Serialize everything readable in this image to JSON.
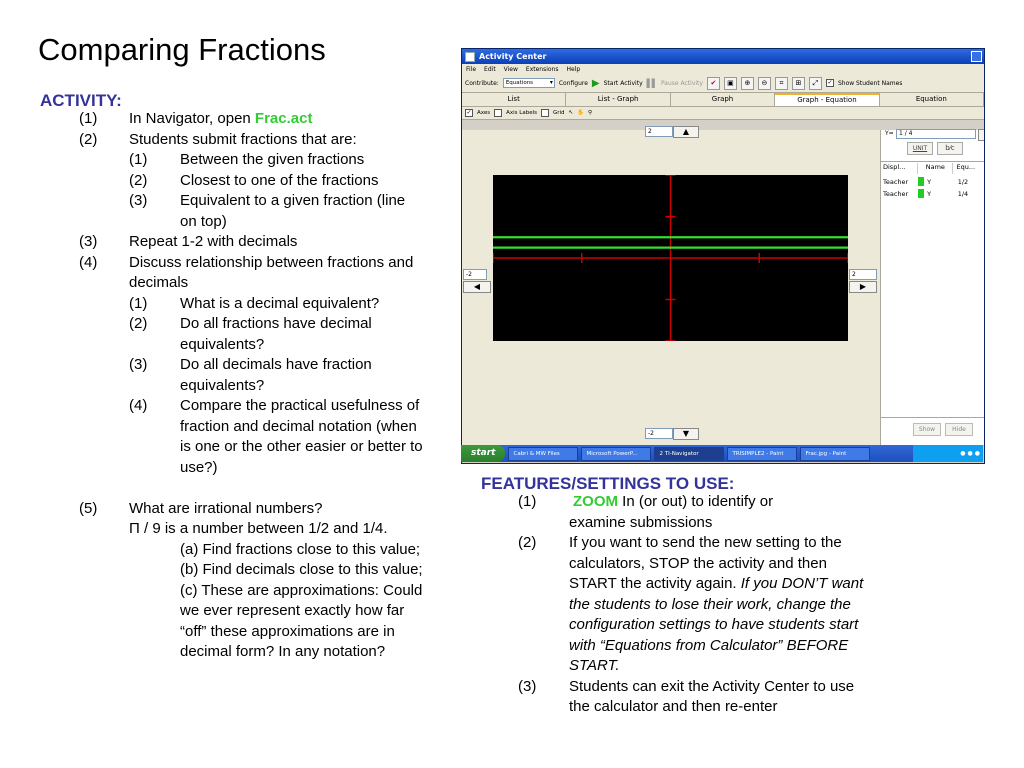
{
  "slide": {
    "title": "Comparing Fractions"
  },
  "activity": {
    "heading": "ACTIVITY:",
    "items": [
      {
        "num": "(1)",
        "prefix": "In Navigator, open ",
        "emph": "Frac.act"
      },
      {
        "num": "(2)",
        "text": "Students submit fractions that are:"
      },
      {
        "num": "(1)",
        "text": "Between the given fractions"
      },
      {
        "num": "(2)",
        "text": "Closest to one of the fractions"
      },
      {
        "num": "(3)",
        "text": "Equivalent to a given fraction (line on top)"
      },
      {
        "num": "(3)",
        "text": "Repeat 1-2 with decimals"
      },
      {
        "num": "(4)",
        "text": "Discuss relationship between fractions and decimals"
      },
      {
        "num": "(1)",
        "text": "What is a decimal equivalent?"
      },
      {
        "num": "(2)",
        "text": "Do all fractions have decimal equivalents?"
      },
      {
        "num": "(3)",
        "text": "Do all decimals have fraction equivalents?"
      },
      {
        "num": "(4)",
        "text": "Compare the practical usefulness of fraction and decimal notation (when is one or the other easier or better to use?)"
      },
      {
        "num": "(5)",
        "text": "What are irrational numbers?"
      },
      {
        "text": "Π / 9 is a number between 1/2 and 1/4."
      },
      {
        "text": "(a) Find fractions close to this value; (b) Find decimals close to this value; (c) These are approximations: Could we ever represent exactly how far “off” these approximations are in decimal form?  In any notation?"
      }
    ]
  },
  "features": {
    "heading": "FEATURES/SETTINGS TO USE:",
    "items": [
      {
        "num": "(1)",
        "emph": "ZOOM",
        "text": " In (or out) to identify or examine submissions"
      },
      {
        "num": "(2)",
        "text": "If you want to send the new setting to the calculators, STOP the activity and then START the activity again. ",
        "italic": "If you DON’T want the students to lose their work, change the configuration settings to have students start with “Equations from Calculator” BEFORE START."
      },
      {
        "num": "(3)",
        "text": "Students can exit the Activity Center to use the calculator and then re-enter"
      }
    ]
  },
  "app": {
    "window_title": "Activity Center",
    "menu": [
      "File",
      "Edit",
      "View",
      "Extensions",
      "Help"
    ],
    "toolbar": {
      "contribute_label": "Contribute:",
      "contribute_value": "Equations",
      "configure": "Configure",
      "start_activity": "Start Activity",
      "pause_activity": "Pause Activity",
      "show_student_names": "Show Student Names"
    },
    "tabs": [
      "List",
      "List - Graph",
      "Graph",
      "Graph - Equation",
      "Equation"
    ],
    "active_tab": "Graph - Equation",
    "graph_options": [
      "Axes",
      "Axis Labels",
      "Grid"
    ],
    "graph": {
      "ymax": "2",
      "ymin": "-2",
      "xmin": "-2",
      "xmax": "2",
      "plot_bg": "#000000",
      "axis_color": "#cc0000",
      "line_color": "#33dd33"
    },
    "equation": {
      "label": "Y=",
      "value": "1 / 4",
      "unit": "UNIT"
    },
    "table": {
      "headers": [
        "Displ...",
        "Name",
        "Equ..."
      ],
      "rows": [
        {
          "display": "Teacher",
          "visible": "Y",
          "eq": "1/2"
        },
        {
          "display": "Teacher",
          "visible": "Y",
          "eq": "1/4"
        }
      ]
    },
    "buttons": {
      "show": "Show",
      "hide": "Hide"
    }
  },
  "taskbar": {
    "start": "start",
    "tasks": [
      "Cabri & MW Files",
      "Microsoft PowerP...",
      "2 TI-Navigator",
      "TRISIMPLE2 - Paint",
      "Frac.jpg - Paint"
    ],
    "active_task": "2 TI-Navigator"
  }
}
